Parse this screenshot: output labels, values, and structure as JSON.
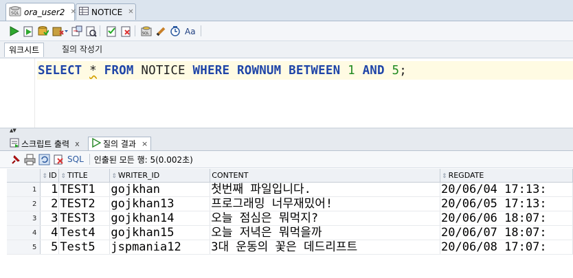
{
  "editor_tabs": [
    {
      "label": "ora_user2",
      "active": true
    },
    {
      "label": "NOTICE",
      "active": false
    }
  ],
  "toolbar_icons": [
    "run-statement-icon",
    "run-script-icon",
    "commit-icon",
    "rollback-icon",
    "autotrace-icon",
    "explain-plan-icon",
    "sql-tuning-icon",
    "clear-icon",
    "unshared-worksheet-icon",
    "history-icon",
    "format-icon"
  ],
  "worksheet_tabs": [
    "워크시트",
    "질의 작성기"
  ],
  "sql": {
    "kw_select": "SELECT",
    "star": "*",
    "kw_from": "FROM",
    "table": "NOTICE",
    "kw_where": "WHERE",
    "col": "ROWNUM",
    "kw_between": "BETWEEN",
    "n1": "1",
    "kw_and": "AND",
    "n2": "5",
    "semi": ";"
  },
  "output_tabs": [
    {
      "label": "스크립트 출력",
      "close": "x",
      "active": false
    },
    {
      "label": "질의 결과",
      "close": "×",
      "active": true
    }
  ],
  "results_toolbar": {
    "sql_label": "SQL",
    "status": "인출된 모든 행: 5(0.002초)"
  },
  "grid": {
    "columns": [
      "ID",
      "TITLE",
      "WRITER_ID",
      "CONTENT",
      "REGDATE"
    ],
    "rows": [
      {
        "rn": "1",
        "id": "1",
        "title": "TEST1",
        "writer": "gojkhan",
        "content": "첫번째 파일입니다.",
        "regdate": "20/06/04 17:13:"
      },
      {
        "rn": "2",
        "id": "2",
        "title": "TEST2",
        "writer": "gojkhan13",
        "content": "프로그래밍 너무재밌어!",
        "regdate": "20/06/05 17:13:"
      },
      {
        "rn": "3",
        "id": "3",
        "title": "TEST3",
        "writer": "gojkhan14",
        "content": "오늘 점심은 뭐먹지?",
        "regdate": "20/06/06 18:07:"
      },
      {
        "rn": "4",
        "id": "4",
        "title": "Test4",
        "writer": "gojkhan15",
        "content": "오늘 저녁은 뭐먹을까",
        "regdate": "20/06/07 18:07:"
      },
      {
        "rn": "5",
        "id": "5",
        "title": "Test5",
        "writer": "jspmania12",
        "content": "3대 운동의 꽃은 데드리프트",
        "regdate": "20/06/08 17:07:"
      }
    ]
  },
  "colors": {
    "keyword": "#1f45a8",
    "number": "#208a20",
    "current_line": "#fffbe3"
  }
}
